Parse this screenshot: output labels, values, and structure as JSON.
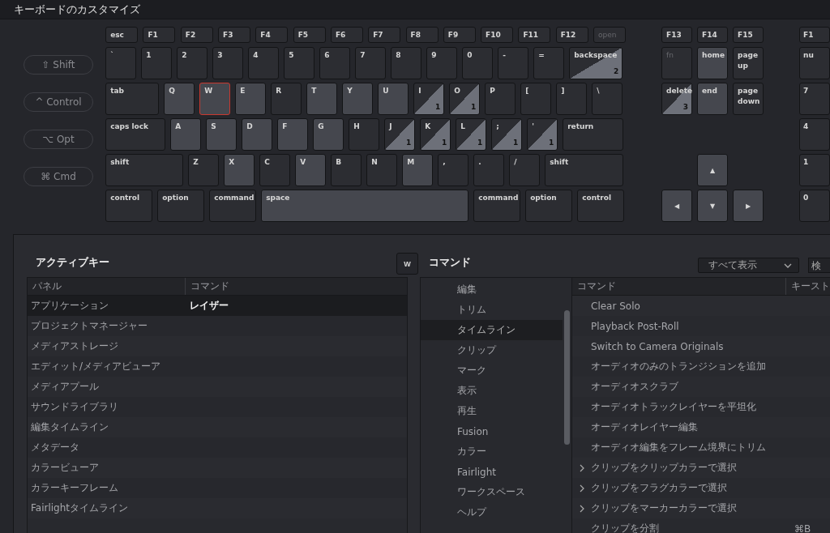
{
  "window": {
    "title": "キーボードのカスタマイズ"
  },
  "modifiers": [
    {
      "label": "⇧ Shift",
      "selected": false
    },
    {
      "label": "^ Control",
      "selected": false
    },
    {
      "label": "⌥ Opt",
      "selected": false
    },
    {
      "label": "⌘ Cmd",
      "selected": false
    }
  ],
  "keyboard": {
    "sections": [
      {
        "kind": "main",
        "rows": [
          {
            "keys": [
              {
                "label": "esc",
                "kind": "dark"
              },
              {
                "label": "F1",
                "kind": "dark"
              },
              {
                "label": "F2",
                "kind": "dark"
              },
              {
                "label": "F3",
                "kind": "dark"
              },
              {
                "label": "F4",
                "kind": "dark"
              },
              {
                "label": "F5",
                "kind": "dark"
              },
              {
                "label": "F6",
                "kind": "dark"
              },
              {
                "label": "F7",
                "kind": "dark"
              },
              {
                "label": "F8",
                "kind": "dark"
              },
              {
                "label": "F9",
                "kind": "dark"
              },
              {
                "label": "F10",
                "kind": "dark"
              },
              {
                "label": "F11",
                "kind": "dark"
              },
              {
                "label": "F12",
                "kind": "dark"
              },
              {
                "label": "open",
                "kind": "disabled"
              }
            ]
          },
          {
            "keys": [
              {
                "label": "`",
                "kind": "dark"
              },
              {
                "label": "1",
                "kind": "dark"
              },
              {
                "label": "2",
                "kind": "dark"
              },
              {
                "label": "3",
                "kind": "dark"
              },
              {
                "label": "4",
                "kind": "dark"
              },
              {
                "label": "5",
                "kind": "dark"
              },
              {
                "label": "6",
                "kind": "dark"
              },
              {
                "label": "7",
                "kind": "dark"
              },
              {
                "label": "8",
                "kind": "dark"
              },
              {
                "label": "9",
                "kind": "dark"
              },
              {
                "label": "0",
                "kind": "dark"
              },
              {
                "label": "-",
                "kind": "dark"
              },
              {
                "label": "=",
                "kind": "dark"
              },
              {
                "label": "backspace",
                "kind": "split",
                "count": "2"
              }
            ]
          },
          {
            "keys": [
              {
                "label": "tab",
                "kind": "dark"
              },
              {
                "label": "Q",
                "kind": "light"
              },
              {
                "label": "W",
                "kind": "light",
                "selected": true
              },
              {
                "label": "E",
                "kind": "light"
              },
              {
                "label": "R",
                "kind": "dark"
              },
              {
                "label": "T",
                "kind": "light"
              },
              {
                "label": "Y",
                "kind": "light"
              },
              {
                "label": "U",
                "kind": "light"
              },
              {
                "label": "I",
                "kind": "split",
                "count": "1"
              },
              {
                "label": "O",
                "kind": "split",
                "count": "1"
              },
              {
                "label": "P",
                "kind": "dark"
              },
              {
                "label": "[",
                "kind": "dark"
              },
              {
                "label": "]",
                "kind": "dark"
              },
              {
                "label": "\\",
                "kind": "dark"
              }
            ]
          },
          {
            "keys": [
              {
                "label": "caps lock",
                "kind": "dark"
              },
              {
                "label": "A",
                "kind": "light"
              },
              {
                "label": "S",
                "kind": "light"
              },
              {
                "label": "D",
                "kind": "light"
              },
              {
                "label": "F",
                "kind": "light"
              },
              {
                "label": "G",
                "kind": "light"
              },
              {
                "label": "H",
                "kind": "dark"
              },
              {
                "label": "J",
                "kind": "split",
                "count": "1"
              },
              {
                "label": "K",
                "kind": "split",
                "count": "1"
              },
              {
                "label": "L",
                "kind": "split",
                "count": "1"
              },
              {
                "label": ";",
                "kind": "split",
                "count": "1"
              },
              {
                "label": "'",
                "kind": "split",
                "count": "1"
              },
              {
                "label": "return",
                "kind": "dark"
              }
            ]
          },
          {
            "keys": [
              {
                "label": "shift",
                "kind": "dark"
              },
              {
                "label": "Z",
                "kind": "dark"
              },
              {
                "label": "X",
                "kind": "light"
              },
              {
                "label": "C",
                "kind": "dark"
              },
              {
                "label": "V",
                "kind": "light"
              },
              {
                "label": "B",
                "kind": "dark"
              },
              {
                "label": "N",
                "kind": "dark"
              },
              {
                "label": "M",
                "kind": "light"
              },
              {
                "label": ",",
                "kind": "dark"
              },
              {
                "label": ".",
                "kind": "dark"
              },
              {
                "label": "/",
                "kind": "dark"
              },
              {
                "label": "shift",
                "kind": "dark"
              }
            ]
          },
          {
            "keys": [
              {
                "label": "control",
                "kind": "dark"
              },
              {
                "label": "option",
                "kind": "dark"
              },
              {
                "label": "command",
                "kind": "dark"
              },
              {
                "label": "space",
                "kind": "light"
              },
              {
                "label": "command",
                "kind": "dark"
              },
              {
                "label": "option",
                "kind": "dark"
              },
              {
                "label": "control",
                "kind": "dark"
              }
            ]
          }
        ]
      },
      {
        "kind": "nav",
        "rows": [
          {
            "keys": [
              {
                "label": "F13",
                "kind": "dark"
              },
              {
                "label": "F14",
                "kind": "dark"
              },
              {
                "label": "F15",
                "kind": "dark"
              }
            ]
          },
          {
            "keys": [
              {
                "label": "fn",
                "kind": "disabled"
              },
              {
                "label": "home",
                "kind": "light"
              },
              {
                "label": "page up",
                "kind": "dark"
              }
            ]
          },
          {
            "keys": [
              {
                "label": "delete",
                "kind": "split",
                "count": "3"
              },
              {
                "label": "end",
                "kind": "light"
              },
              {
                "label": "page down",
                "kind": "dark"
              }
            ]
          },
          {
            "keys": [
              {
                "label": "▲",
                "kind": "light"
              }
            ]
          },
          {
            "keys": [
              {
                "label": "◀",
                "kind": "light"
              },
              {
                "label": "▼",
                "kind": "light"
              },
              {
                "label": "▶",
                "kind": "light"
              }
            ]
          }
        ]
      },
      {
        "kind": "numpad",
        "rows": [
          {
            "keys": [
              {
                "label": "F1",
                "kind": "dark"
              }
            ]
          },
          {
            "keys": [
              {
                "label": "nu",
                "kind": "dark"
              }
            ]
          },
          {
            "keys": [
              {
                "label": "7",
                "kind": "dark"
              }
            ]
          },
          {
            "keys": [
              {
                "label": "4",
                "kind": "dark"
              }
            ]
          },
          {
            "keys": [
              {
                "label": "1",
                "kind": "dark"
              }
            ]
          },
          {
            "keys": [
              {
                "label": "0",
                "kind": "dark"
              }
            ]
          }
        ]
      }
    ]
  },
  "active_keys": {
    "title": "アクティブキー",
    "key_button": "W",
    "columns": [
      "パネル",
      "コマンド"
    ],
    "rows": [
      {
        "panel": "アプリケーション",
        "command": "レイザー",
        "selected": true
      },
      {
        "panel": "プロジェクトマネージャー",
        "selected": false
      },
      {
        "panel": "メディアストレージ",
        "selected": false
      },
      {
        "panel": "エディット/メディアビューア",
        "selected": false
      },
      {
        "panel": "メディアプール",
        "selected": false
      },
      {
        "panel": "サウンドライブラリ",
        "selected": false
      },
      {
        "panel": "編集タイムライン",
        "selected": false
      },
      {
        "panel": "メタデータ",
        "selected": false
      },
      {
        "panel": "カラービューア",
        "selected": false
      },
      {
        "panel": "カラーキーフレーム",
        "selected": false
      },
      {
        "panel": "Fairlightタイムライン",
        "selected": false
      }
    ]
  },
  "commands": {
    "title": "コマンド",
    "filter": "すべて表示",
    "search": {
      "placeholder": "検"
    },
    "categories": [
      {
        "label": "編集",
        "selected": false
      },
      {
        "label": "トリム",
        "selected": false
      },
      {
        "label": "タイムライン",
        "selected": true
      },
      {
        "label": "クリップ",
        "selected": false
      },
      {
        "label": "マーク",
        "selected": false
      },
      {
        "label": "表示",
        "selected": false
      },
      {
        "label": "再生",
        "selected": false
      },
      {
        "label": "Fusion",
        "selected": false
      },
      {
        "label": "カラー",
        "selected": false
      },
      {
        "label": "Fairlight",
        "selected": false
      },
      {
        "label": "ワークスペース",
        "selected": false
      },
      {
        "label": "ヘルプ",
        "selected": false
      }
    ],
    "columns": [
      "コマンド",
      "キースト"
    ],
    "rows": [
      {
        "kind": "command",
        "name": "Clear Solo"
      },
      {
        "kind": "command",
        "name": "Playback Post-Roll"
      },
      {
        "kind": "command",
        "name": "Switch to Camera Originals"
      },
      {
        "kind": "command",
        "name": "オーディオのみのトランジションを追加"
      },
      {
        "kind": "command",
        "name": "オーディオスクラブ"
      },
      {
        "kind": "command",
        "name": "オーディオトラックレイヤーを平坦化"
      },
      {
        "kind": "command",
        "name": "オーディオレイヤー編集"
      },
      {
        "kind": "command",
        "name": "オーディオ編集をフレーム境界にトリム"
      },
      {
        "kind": "group",
        "name": "クリップをクリップカラーで選択",
        "expanded": false
      },
      {
        "kind": "group",
        "name": "クリップをフラグカラーで選択",
        "expanded": false
      },
      {
        "kind": "group",
        "name": "クリップをマーカーカラーで選択",
        "expanded": false
      },
      {
        "kind": "command",
        "name": "クリップを分割",
        "keystroke": "⌘B"
      }
    ]
  }
}
